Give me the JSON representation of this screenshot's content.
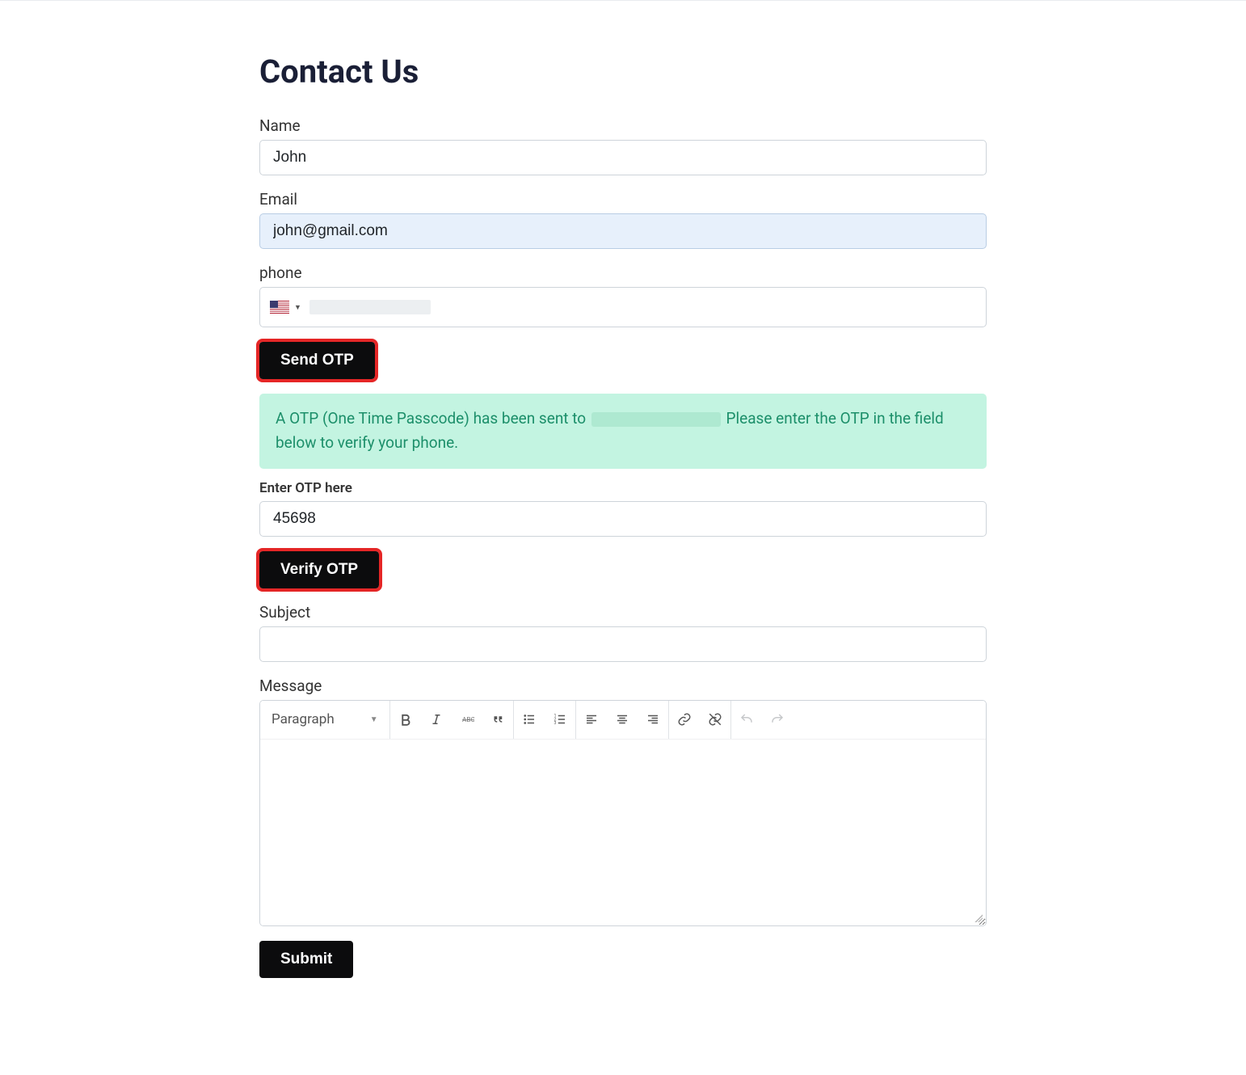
{
  "title": "Contact Us",
  "labels": {
    "name": "Name",
    "email": "Email",
    "phone": "phone",
    "otp": "Enter OTP here",
    "subject": "Subject",
    "message": "Message"
  },
  "values": {
    "name": "John",
    "email": "john@gmail.com",
    "phone_display": "",
    "otp": "45698",
    "subject": "",
    "message": ""
  },
  "buttons": {
    "send_otp": "Send OTP",
    "verify_otp": "Verify OTP",
    "submit": "Submit"
  },
  "alert": {
    "prefix": "A OTP (One Time Passcode) has been sent to ",
    "suffix": " Please enter the OTP in the field below to verify your phone."
  },
  "editor": {
    "format": "Paragraph"
  },
  "country": "US"
}
